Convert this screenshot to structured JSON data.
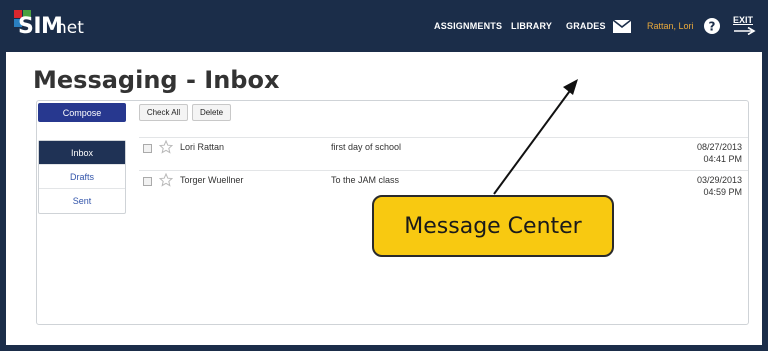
{
  "brand": {
    "main": "SIM",
    "sub": "net",
    "colors": {
      "red": "#d9272e",
      "green": "#4aa03f",
      "blue": "#2a7fc1"
    }
  },
  "nav": {
    "assignments": "ASSIGNMENTS",
    "library": "LIBRARY",
    "grades": "GRADES",
    "user": "Rattan, Lori",
    "exit": "EXIT"
  },
  "page": {
    "title": "Messaging - Inbox"
  },
  "toolbar": {
    "compose": "Compose",
    "check_all": "Check All",
    "delete": "Delete"
  },
  "folders": [
    {
      "label": "Inbox",
      "active": true
    },
    {
      "label": "Drafts",
      "active": false
    },
    {
      "label": "Sent",
      "active": false
    }
  ],
  "messages": [
    {
      "sender": "Lori Rattan",
      "subject": "first day of school",
      "date": "08/27/2013",
      "time": "04:41 PM"
    },
    {
      "sender": "Torger Wuellner",
      "subject": "To the JAM class",
      "date": "03/29/2013",
      "time": "04:59 PM"
    }
  ],
  "callout": {
    "text": "Message Center"
  },
  "colors": {
    "header": "#1b2d49",
    "accent": "#27388f",
    "user": "#e9a93b",
    "callout": "#f8c911"
  }
}
